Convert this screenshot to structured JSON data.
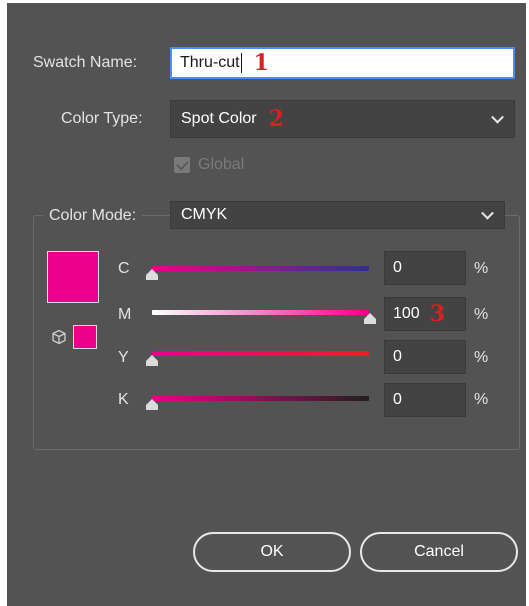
{
  "swatch_name": {
    "label": "Swatch Name:",
    "value": "Thru-cut",
    "marker": "1"
  },
  "color_type": {
    "label": "Color Type:",
    "value": "Spot Color",
    "marker": "2"
  },
  "global": {
    "label": "Global",
    "checked": true
  },
  "color_mode": {
    "label": "Color Mode:",
    "value": "CMYK"
  },
  "channels": [
    {
      "letter": "C",
      "value": "0",
      "unit": "%",
      "level": 0
    },
    {
      "letter": "M",
      "value": "100",
      "unit": "%",
      "level": 100,
      "marker": "3"
    },
    {
      "letter": "Y",
      "value": "0",
      "unit": "%",
      "level": 0
    },
    {
      "letter": "K",
      "value": "0",
      "unit": "%",
      "level": 0
    }
  ],
  "buttons": {
    "ok": "OK",
    "cancel": "Cancel"
  },
  "colors": {
    "dialog_bg": "#535353",
    "swatch": "#ec008c",
    "marker": "#d8201e",
    "focus": "#4a8df6"
  },
  "icons": {
    "spot_indicator": "cube-icon"
  }
}
